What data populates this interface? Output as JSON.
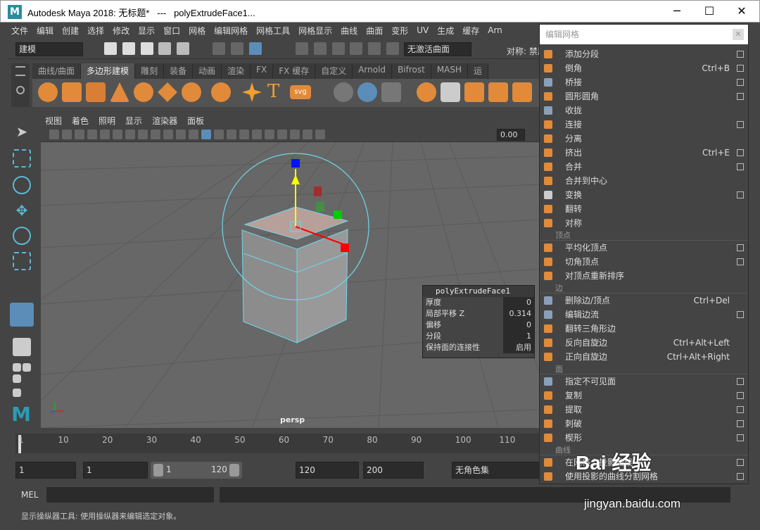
{
  "window": {
    "title": "Autodesk Maya 2018: 无标题*   ---   polyExtrudeFace1...",
    "logo": "M",
    "min": "─",
    "max": "☐",
    "close": "✕"
  },
  "menubar": [
    "文件",
    "编辑",
    "创建",
    "选择",
    "修改",
    "显示",
    "窗口",
    "网格",
    "编辑网格",
    "网格工具",
    "网格显示",
    "曲线",
    "曲面",
    "变形",
    "UV",
    "生成",
    "缓存",
    "Arn"
  ],
  "statusline": {
    "mode": "建模",
    "live_surface": "无激活曲面",
    "symmetry": "对称: 禁用"
  },
  "shelf_tabs": [
    "曲线/曲面",
    "多边形建模",
    "雕刻",
    "装备",
    "动画",
    "渲染",
    "FX",
    "FX 缓存",
    "自定义",
    "Arnold",
    "Bifrost",
    "MASH",
    "运"
  ],
  "shelf_active": 1,
  "viewport": {
    "menu": [
      "视图",
      "着色",
      "照明",
      "显示",
      "渲染器",
      "面板"
    ],
    "field_value": "0.00",
    "camera_label": "persp"
  },
  "channel_box": {
    "title": "polyExtrudeFace1",
    "rows": [
      {
        "label": "厚度",
        "value": "0"
      },
      {
        "label": "局部平移 Z",
        "value": "0.314"
      },
      {
        "label": "偏移",
        "value": "0"
      },
      {
        "label": "分段",
        "value": "1"
      },
      {
        "label": "保持面的连接性",
        "value": "启用"
      }
    ]
  },
  "timeline": {
    "ticks": [
      "1",
      "10",
      "20",
      "30",
      "40",
      "50",
      "60",
      "70",
      "80",
      "90",
      "100",
      "110"
    ]
  },
  "range": {
    "start": "1",
    "anim_start": "1",
    "slider_start": "1",
    "slider_end": "120",
    "end": "120",
    "anim_end": "200",
    "char_set": "无角色集"
  },
  "mel": {
    "label": "MEL"
  },
  "help": "显示操纵器工具: 使用操纵器来编辑选定对象。",
  "panel": {
    "title": "编辑网格",
    "close": "✕",
    "groups": [
      {
        "section": "",
        "items": [
          {
            "label": "添加分段",
            "shortcut": "",
            "box": true,
            "color": "#e08a3a"
          },
          {
            "label": "倒角",
            "shortcut": "Ctrl+B",
            "box": true,
            "color": "#e08a3a"
          },
          {
            "label": "桥接",
            "shortcut": "",
            "box": true,
            "color": "#8aa0b8"
          },
          {
            "label": "圆形圆角",
            "shortcut": "",
            "box": true,
            "color": "#e08a3a"
          },
          {
            "label": "收拢",
            "shortcut": "",
            "box": false,
            "color": "#8aa0b8"
          },
          {
            "label": "连接",
            "shortcut": "",
            "box": true,
            "color": "#e08a3a"
          },
          {
            "label": "分离",
            "shortcut": "",
            "box": false,
            "color": "#e08a3a"
          },
          {
            "label": "挤出",
            "shortcut": "Ctrl+E",
            "box": true,
            "color": "#e08a3a"
          },
          {
            "label": "合并",
            "shortcut": "",
            "box": true,
            "color": "#e08a3a"
          },
          {
            "label": "合并到中心",
            "shortcut": "",
            "box": false,
            "color": "#e08a3a"
          },
          {
            "label": "变换",
            "shortcut": "",
            "box": true,
            "color": "#cccccc"
          },
          {
            "label": "翻转",
            "shortcut": "",
            "box": false,
            "color": "#e08a3a"
          },
          {
            "label": "对称",
            "shortcut": "",
            "box": false,
            "color": "#e08a3a"
          }
        ]
      },
      {
        "section": "顶点",
        "items": [
          {
            "label": "平均化顶点",
            "shortcut": "",
            "box": true,
            "color": "#e08a3a"
          },
          {
            "label": "切角顶点",
            "shortcut": "",
            "box": true,
            "color": "#e08a3a"
          },
          {
            "label": "对顶点重新排序",
            "shortcut": "",
            "box": false,
            "color": "#e08a3a"
          }
        ]
      },
      {
        "section": "边",
        "items": [
          {
            "label": "删除边/顶点",
            "shortcut": "Ctrl+Del",
            "box": false,
            "color": "#8aa0b8"
          },
          {
            "label": "编辑边流",
            "shortcut": "",
            "box": true,
            "color": "#8aa0b8"
          },
          {
            "label": "翻转三角形边",
            "shortcut": "",
            "box": false,
            "color": "#e08a3a"
          },
          {
            "label": "反向自旋边",
            "shortcut": "Ctrl+Alt+Left",
            "box": false,
            "color": "#e08a3a"
          },
          {
            "label": "正向自旋边",
            "shortcut": "Ctrl+Alt+Right",
            "box": false,
            "color": "#e08a3a"
          }
        ]
      },
      {
        "section": "面",
        "items": [
          {
            "label": "指定不可见面",
            "shortcut": "",
            "box": true,
            "color": "#8aa0b8"
          },
          {
            "label": "复制",
            "shortcut": "",
            "box": true,
            "color": "#e08a3a"
          },
          {
            "label": "提取",
            "shortcut": "",
            "box": true,
            "color": "#e08a3a"
          },
          {
            "label": "刺破",
            "shortcut": "",
            "box": true,
            "color": "#e08a3a"
          },
          {
            "label": "楔形",
            "shortcut": "",
            "box": true,
            "color": "#e08a3a"
          }
        ]
      },
      {
        "section": "曲线",
        "items": [
          {
            "label": "在网格上投影曲线",
            "shortcut": "",
            "box": true,
            "color": "#e08a3a"
          },
          {
            "label": "使用投影的曲线分割网格",
            "shortcut": "",
            "box": true,
            "color": "#e08a3a"
          }
        ]
      }
    ]
  },
  "watermark": {
    "brand": "Bai 经验",
    "url": "jingyan.baidu.com"
  }
}
